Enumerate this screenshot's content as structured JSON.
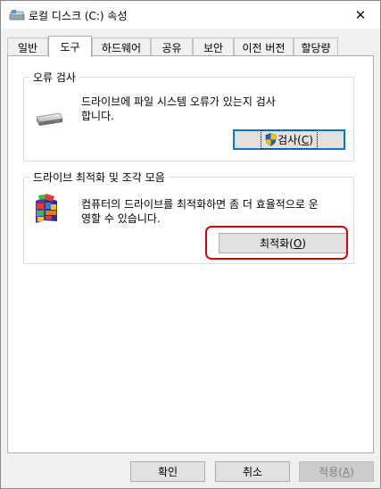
{
  "window": {
    "title": "로컬 디스크 (C:) 속성",
    "close_glyph": "✕"
  },
  "tabs": [
    {
      "label": "일반"
    },
    {
      "label": "도구",
      "active": true
    },
    {
      "label": "하드웨어"
    },
    {
      "label": "공유"
    },
    {
      "label": "보안"
    },
    {
      "label": "이전 버전"
    },
    {
      "label": "할당량"
    }
  ],
  "error_check": {
    "title": "오류 검사",
    "description_line1": "드라이브에 파일 시스템 오류가 있는지 검사",
    "description_line2": "합니다.",
    "button_label": "검사(",
    "button_mnemonic": "C",
    "button_suffix": ")",
    "icon": "drive-icon"
  },
  "optimize": {
    "title": "드라이브 최적화 및 조각 모음",
    "description_line1": "컴퓨터의 드라이브를 최적화하면 좀 더 효율적으로 운",
    "description_line2": "영할 수 있습니다.",
    "button_label": "최적화(",
    "button_mnemonic": "O",
    "button_suffix": ")",
    "icon": "defrag-icon"
  },
  "footer": {
    "ok_label": "확인",
    "cancel_label": "취소",
    "apply_label": "적용(",
    "apply_mnemonic": "A",
    "apply_suffix": ")"
  },
  "colors": {
    "highlight": "#e00000",
    "focus_border": "#0078d7",
    "shield_blue": "#1f5fbf",
    "shield_yellow": "#f2c500"
  }
}
